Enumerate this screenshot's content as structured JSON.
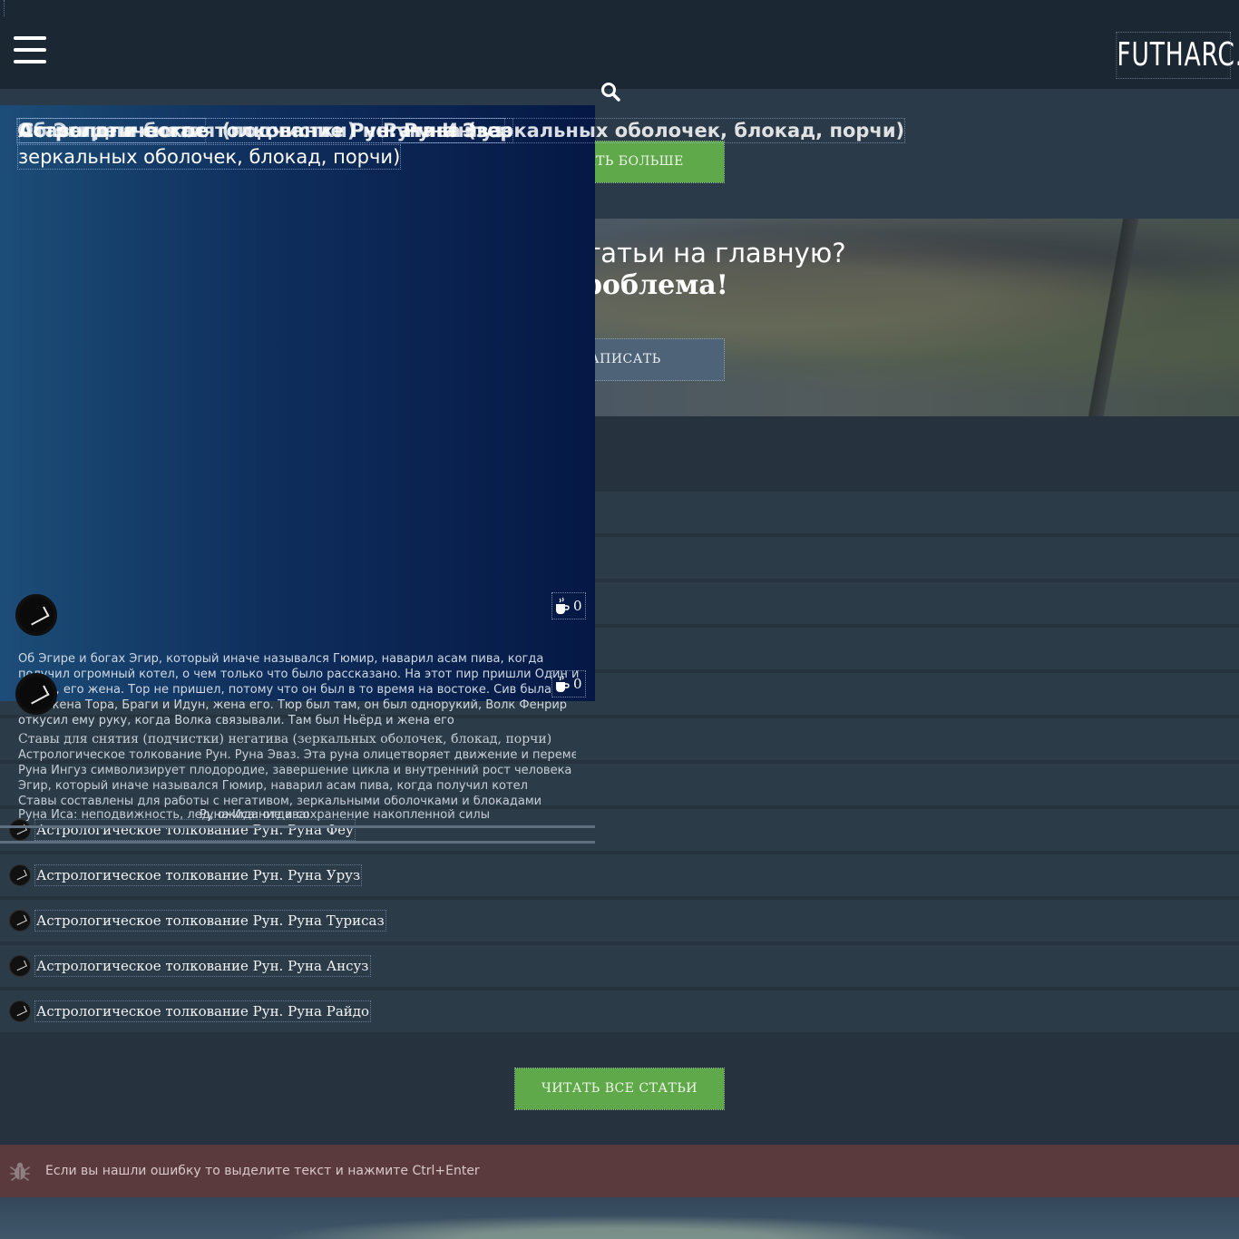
{
  "header": {
    "logo": "FUTHARC.RU"
  },
  "buttons": {
    "read_more": "ЧИТАТЬ БОЛЬШЕ",
    "read_more_visible": "ТЬ БОЛЬШЕ",
    "write": "НАПИСАТЬ",
    "read_all": "ЧИТАТЬ ВСЕ СТАТЬИ"
  },
  "promo": {
    "title": "Хотите свои статьи на главную?",
    "subtitle": "Не проблема!"
  },
  "featured": {
    "title_layers": [
      "Астрологическое толкование Рун. Руна Эваз",
      "Ставы для снятия (подчистки) негатива (зеркальных оболочек, блокад, порчи)",
      "Об Эгире и богах",
      "Руна Ингуз"
    ],
    "title_line2": "зеркальных оболочек, блокад, порчи)",
    "comments_count": "0",
    "comments_count_2": "0",
    "excerpt": "Об Эгире и богах Эгир, который иначе назывался Гюмир, наварил асам пива, когда получил огромный котел, о чем только что было рассказано. На этот пир пришли Один и Фригг, его жена. Тор не пришел, потому что он был в то время на востоке. Сив была там, жена Тора, Браги и Идун, жена его. Тюр был там, он был однорукий, Волк Фенрир откусил ему руку, когда Волка связывали. Там был Ньёрд и жена его",
    "ghost_lines": [
      "Ставы для снятия (подчистки) негатива (зеркальных оболочек, блокад, порчи)",
      "Астрологическое толкование Рун. Руна Эваз. Эта руна олицетворяет движение и перемены",
      "Руна Ингуз символизирует плодородие, завершение цикла и внутренний рост человека",
      "Эгир, который иначе назывался Гюмир, наварил асам пива, когда получил котел",
      "Ставы составлены для работы с негативом, зеркальными оболочками и блокадами",
      "Руна Иса: неподвижность, лед, ожидание и сохранение накопленной силы",
      "Руна Иса: отдавание"
    ]
  },
  "list": {
    "items": [
      "Астрологическое толкование Рун. Руна Феу",
      "Астрологическое толкование Рун. Руна Уруз",
      "Астрологическое толкование Рун. Руна Турисаз",
      "Астрологическое толкование Рун. Руна Ансуз",
      "Астрологическое толкование Рун. Руна Райдо"
    ]
  },
  "error_bar": {
    "text": "Если вы нашли ошибку то выделите текст и нажмите Ctrl+Enter"
  },
  "colors": {
    "header_bg": "#1b2733",
    "accent_green": "#5fa94a",
    "write_button": "#4e6377",
    "error_bar_bg": "#5b3a3e",
    "featured_gradient_start": "#1c4d78",
    "featured_gradient_end": "#051845"
  },
  "icons": {
    "menu": "hamburger-icon",
    "search": "search-icon",
    "comments": "coffee-cup-icon",
    "error": "bug-icon"
  }
}
